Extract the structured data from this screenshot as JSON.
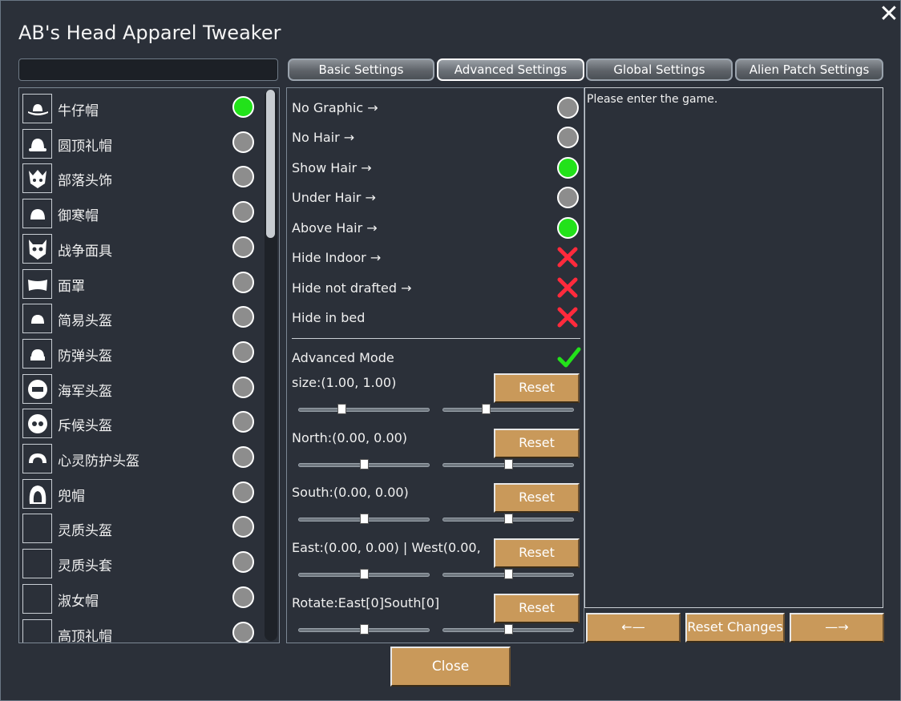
{
  "window": {
    "title": "AB's Head Apparel Tweaker",
    "close_glyph": "✕",
    "search_value": ""
  },
  "tabs": [
    {
      "label": "Basic Settings",
      "active": false
    },
    {
      "label": "Advanced Settings",
      "active": true
    },
    {
      "label": "Global Settings",
      "active": false
    },
    {
      "label": "Alien Patch Settings",
      "active": false
    }
  ],
  "apparel_list": [
    {
      "label": "牛仔帽",
      "icon": "cowboy-hat-icon",
      "selected": true
    },
    {
      "label": "圆顶礼帽",
      "icon": "bowler-hat-icon",
      "selected": false
    },
    {
      "label": "部落头饰",
      "icon": "tribal-headdress-icon",
      "selected": false
    },
    {
      "label": "御寒帽",
      "icon": "tuque-icon",
      "selected": false
    },
    {
      "label": "战争面具",
      "icon": "war-mask-icon",
      "selected": false
    },
    {
      "label": "面罩",
      "icon": "veil-icon",
      "selected": false
    },
    {
      "label": "简易头盔",
      "icon": "simple-helmet-icon",
      "selected": false
    },
    {
      "label": "防弹头盔",
      "icon": "flak-helmet-icon",
      "selected": false
    },
    {
      "label": "海军头盔",
      "icon": "marine-helmet-icon",
      "selected": false
    },
    {
      "label": "斥候头盔",
      "icon": "recon-helmet-icon",
      "selected": false
    },
    {
      "label": "心灵防护头盔",
      "icon": "psychic-foil-helmet-icon",
      "selected": false
    },
    {
      "label": "兜帽",
      "icon": "hood-icon",
      "selected": false
    },
    {
      "label": "灵质头盔",
      "icon": "blank-icon",
      "selected": false
    },
    {
      "label": "灵质头套",
      "icon": "blank-icon",
      "selected": false
    },
    {
      "label": "淑女帽",
      "icon": "blank-icon",
      "selected": false
    },
    {
      "label": "高顶礼帽",
      "icon": "blank-icon",
      "selected": false
    }
  ],
  "settings": {
    "toggles": [
      {
        "label": "No Graphic →",
        "state": "off"
      },
      {
        "label": "No Hair →",
        "state": "off"
      },
      {
        "label": "Show Hair →",
        "state": "on"
      },
      {
        "label": "Under Hair →",
        "state": "off"
      },
      {
        "label": "Above Hair →",
        "state": "on"
      },
      {
        "label": "Hide Indoor →",
        "state": "disabled"
      },
      {
        "label": "Hide not drafted →",
        "state": "disabled"
      },
      {
        "label": "Hide in bed",
        "state": "disabled"
      }
    ],
    "advanced_mode": {
      "label": "Advanced Mode",
      "checked": true
    },
    "sliders": [
      {
        "label": "size:(1.00, 1.00)",
        "reset": "Reset",
        "values": [
          0.33,
          0.33
        ]
      },
      {
        "label": "North:(0.00, 0.00)",
        "reset": "Reset",
        "values": [
          0.5,
          0.5
        ]
      },
      {
        "label": "South:(0.00, 0.00)",
        "reset": "Reset",
        "values": [
          0.5,
          0.5
        ]
      },
      {
        "label": "East:(0.00, 0.00) | West(0.00,",
        "reset": "Reset",
        "values": [
          0.5,
          0.5
        ]
      },
      {
        "label": "Rotate:East[0]South[0]",
        "reset": "Reset",
        "values": [
          0.5,
          0.5
        ]
      }
    ]
  },
  "info": {
    "message": "Please enter the game."
  },
  "buttons": {
    "prev": "←—",
    "reset_changes": "Reset Changes",
    "next": "—→",
    "close": "Close"
  },
  "colors": {
    "on": "#22e21a",
    "off": "#8d8d8d",
    "disabled": "#ff2a3c",
    "check": "#22e21a",
    "button": "#c9995a"
  }
}
